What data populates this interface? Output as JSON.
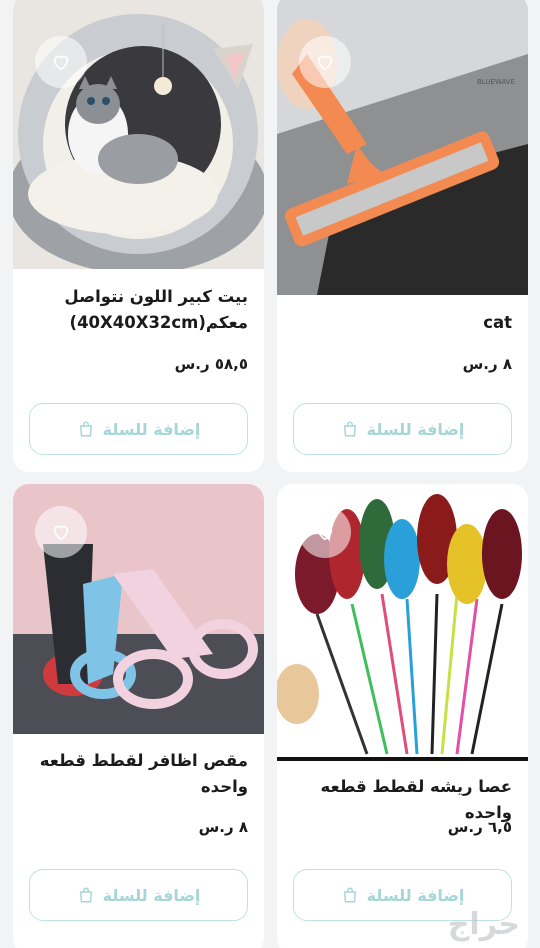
{
  "products": [
    {
      "id": "cat-bed",
      "title": "بيت كبير اللون نتواصل معكم(40X40X32cm)",
      "price": "٥٨,٥ ر.س",
      "add_label": "إضافة للسلة"
    },
    {
      "id": "lint-brush",
      "title": "cat",
      "price": "٨ ر.س",
      "add_label": "إضافة للسلة"
    },
    {
      "id": "nail-clipper",
      "title": "مقص اظافر لقطط قطعه واحده",
      "price": "٨ ر.س",
      "add_label": "إضافة للسلة"
    },
    {
      "id": "feather-wand",
      "title": "عصا ريشه لقطط قطعه واحده",
      "price": "٦,٥ ر.س",
      "add_label": "إضافة للسلة"
    }
  ],
  "watermark": "حراج",
  "colors": {
    "button_border": "#bfe3e3",
    "button_text": "#a6d6d6",
    "background": "#f2f3f5"
  }
}
